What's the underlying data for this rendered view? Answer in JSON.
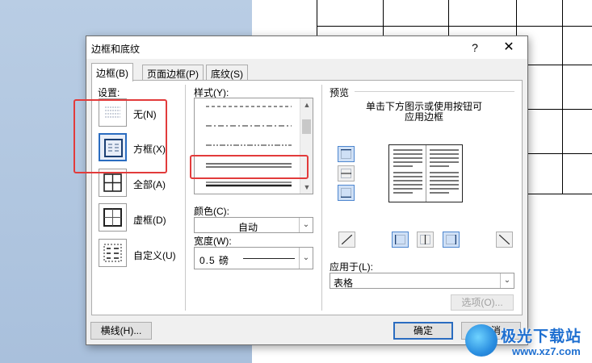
{
  "dialog": {
    "title": "边框和底纹",
    "help": "?",
    "close": "✕"
  },
  "tabs": [
    {
      "label": "边框(B)",
      "active": true
    },
    {
      "label": "页面边框(P)",
      "active": false
    },
    {
      "label": "底纹(S)",
      "active": false
    }
  ],
  "settings": {
    "label": "设置:",
    "items": [
      {
        "label": "无(N)",
        "icon": "setting-none-icon",
        "selected": false
      },
      {
        "label": "方框(X)",
        "icon": "setting-box-icon",
        "selected": true
      },
      {
        "label": "全部(A)",
        "icon": "setting-all-icon",
        "selected": false
      },
      {
        "label": "虚框(D)",
        "icon": "setting-grid-icon",
        "selected": false
      },
      {
        "label": "自定义(U)",
        "icon": "setting-custom-icon",
        "selected": false
      }
    ]
  },
  "style": {
    "label": "样式(Y):",
    "options": [
      "dashed",
      "dash-dot",
      "dash-dot-dot",
      "double",
      "thin-thick"
    ],
    "selected": "double"
  },
  "color": {
    "label": "颜色(C):",
    "value": "自动"
  },
  "width": {
    "label": "宽度(W):",
    "value": "0.5 磅"
  },
  "preview": {
    "label": "预览",
    "hint_line1": "单击下方图示或使用按钮可",
    "hint_line2": "应用边框"
  },
  "apply_to": {
    "label": "应用于(L):",
    "value": "表格"
  },
  "buttons": {
    "options": "选项(O)...",
    "horizontal_line": "横线(H)...",
    "ok": "确定",
    "cancel": "取消"
  },
  "watermark": {
    "name": "极光下载站",
    "url": "www.xz7.com"
  },
  "colors": {
    "accent": "#2a6cc0",
    "annotation": "#e23b3b"
  }
}
